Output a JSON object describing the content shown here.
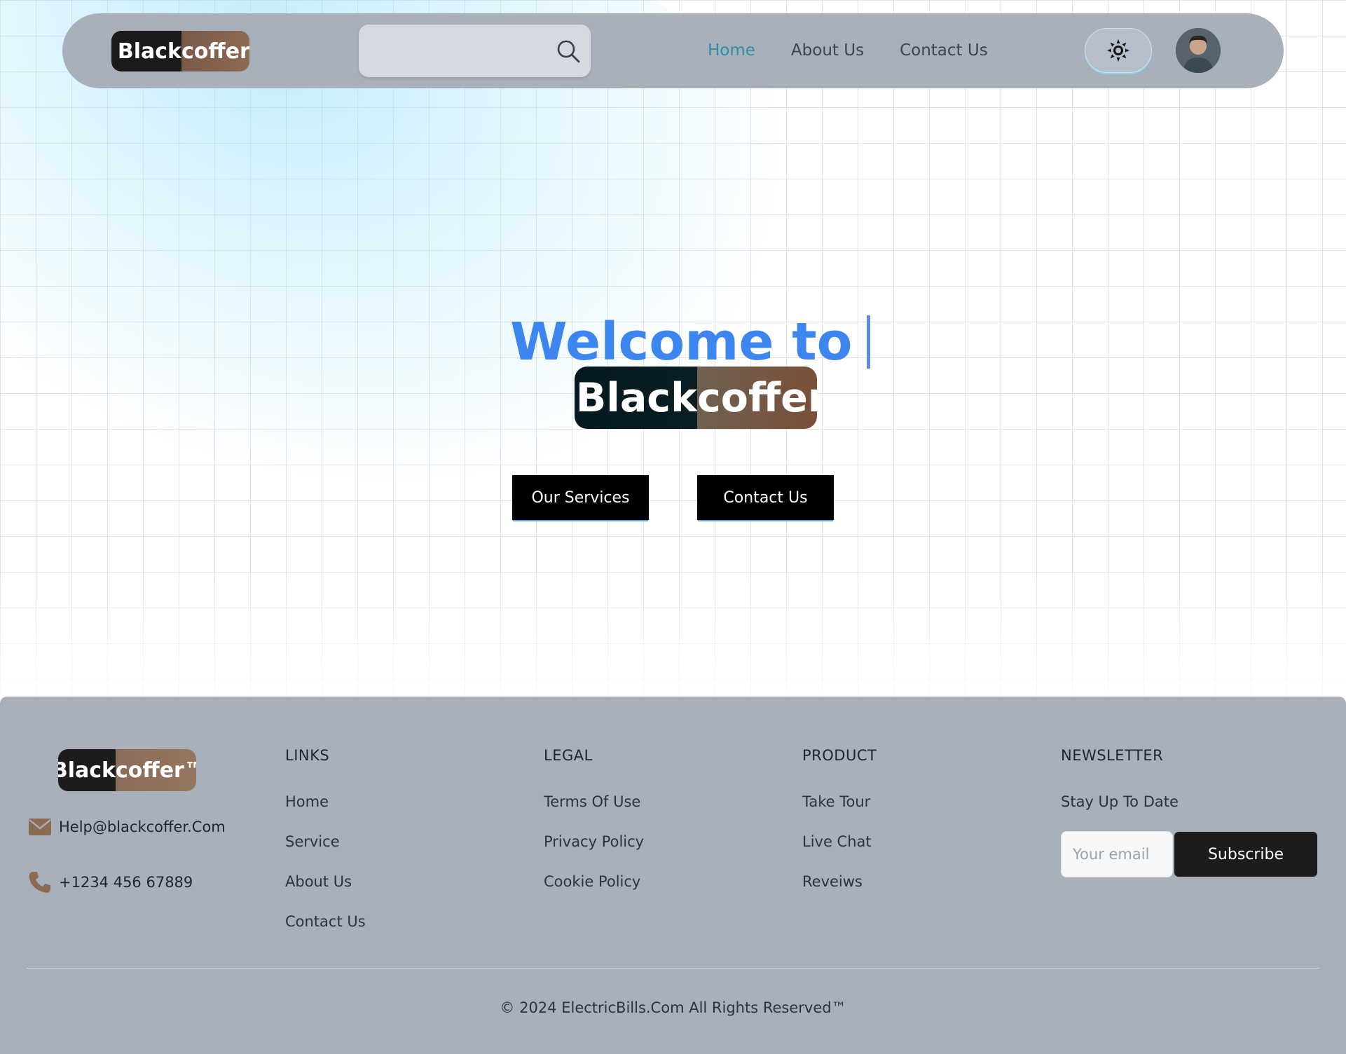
{
  "header": {
    "logo": {
      "part1": "Black",
      "part2": "coffer"
    },
    "search": {
      "placeholder": "",
      "value": ""
    },
    "nav": [
      {
        "label": "Home",
        "active": true
      },
      {
        "label": "About Us",
        "active": false
      },
      {
        "label": "Contact Us",
        "active": false
      }
    ],
    "theme_icon": "sun-icon",
    "avatar_icon": "user-avatar"
  },
  "hero": {
    "title": "Welcome to",
    "logo": {
      "part1": "Black",
      "part2": "coffer"
    },
    "buttons": {
      "services": "Our Services",
      "contact": "Contact Us"
    }
  },
  "footer": {
    "logo": {
      "part1": "Black",
      "part2": "coffer™"
    },
    "email": "Help@blackcoffer.Com",
    "phone": "+1234 456 67889",
    "columns": {
      "links": {
        "title": "LINKS",
        "items": [
          "Home",
          "Service",
          "About Us",
          "Contact Us"
        ]
      },
      "legal": {
        "title": "LEGAL",
        "items": [
          "Terms Of Use",
          "Privacy Policy",
          "Cookie Policy"
        ]
      },
      "product": {
        "title": "PRODUCT",
        "items": [
          "Take Tour",
          "Live Chat",
          "Reveiws"
        ]
      },
      "newsletter": {
        "title": "NEWSLETTER",
        "tagline": "Stay Up To Date",
        "input_placeholder": "Your email",
        "button": "Subscribe"
      }
    },
    "copyright": "© 2024 ElectricBills.Com All Rights Reserved™"
  },
  "colors": {
    "accent": "#3e86ef",
    "nav_active": "#2d8ea4",
    "bar_bg": "#a8b0bc",
    "button_bg": "#000000"
  }
}
